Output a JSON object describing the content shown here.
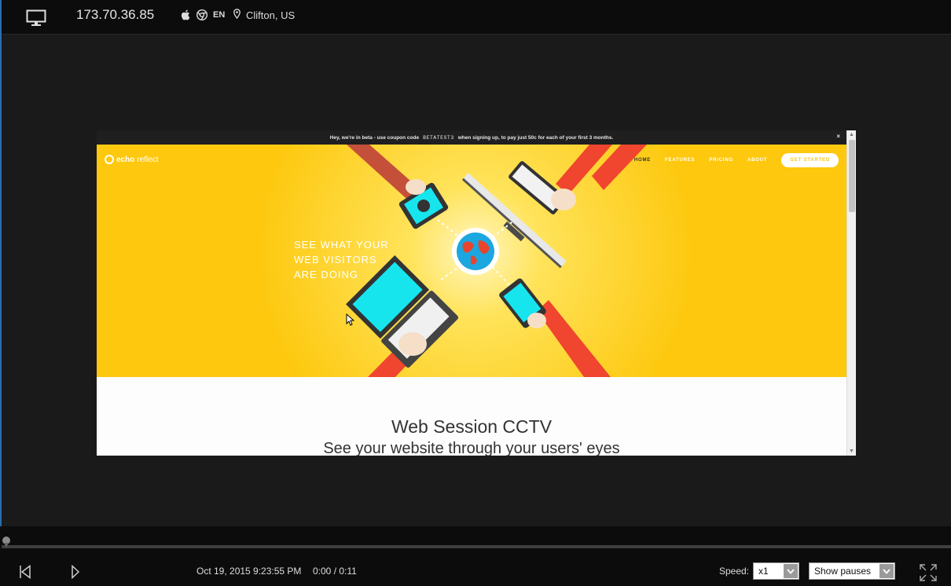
{
  "header": {
    "ip": "173.70.36.85",
    "os_icon": "apple-icon",
    "browser_icon": "chrome-icon",
    "language": "EN",
    "location": "Clifton, US"
  },
  "recorded_site": {
    "beta_banner": {
      "lead": "Hey, we're in beta - use coupon code",
      "code": "BETATEST3",
      "tail": "when signing up, to pay just 50c for each of your first 3 months.",
      "close": "×"
    },
    "logo": {
      "bold": "echo",
      "light": "reflect"
    },
    "nav": {
      "home": "HOME",
      "features": "FEATURES",
      "pricing": "PRICING",
      "about": "ABOUT",
      "cta": "GET STARTED"
    },
    "tagline": [
      "SEE WHAT YOUR",
      "WEB VISITORS",
      "ARE DOING"
    ],
    "heading": "Web Session CCTV",
    "subheading": "See your website through your users' eyes",
    "colors": {
      "hero": "#fdc80e",
      "arm": "#f0452e",
      "screen": "#17e5ee",
      "globe_sea": "#1ca7e0",
      "globe_land": "#e8452c"
    }
  },
  "player": {
    "datetime": "Oct 19, 2015 9:23:55 PM",
    "timecode": "0:00 / 0:11",
    "progress": 0.0,
    "speed_label": "Speed:",
    "speed_value": "x1",
    "pauses_value": "Show pauses"
  }
}
